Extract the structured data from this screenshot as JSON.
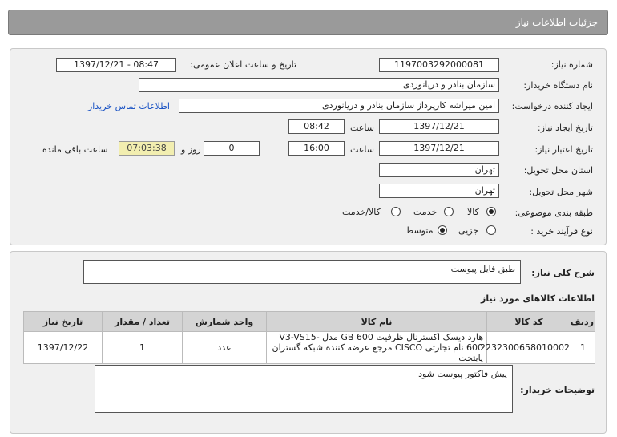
{
  "header": {
    "title": "جزئیات اطلاعات نیاز"
  },
  "info": {
    "need_number_label": "شماره نیاز:",
    "need_number": "1197003292000081",
    "announce_label": "تاریخ و ساعت اعلان عمومی:",
    "announce_value": "1397/12/21 - 08:47",
    "buyer_org_label": "نام دستگاه خریدار:",
    "buyer_org": "سازمان بنادر و دریانوردی",
    "requester_label": "ایجاد کننده درخواست:",
    "requester": "امین میراشه کارپرداز سازمان بنادر و دریانوردی",
    "contact_link": "اطلاعات تماس خریدار",
    "created_label": "تاریخ ایجاد نیاز:",
    "created_date": "1397/12/21",
    "time_label": "ساعت",
    "created_time": "08:42",
    "validity_label": "تاریخ اعتبار نیاز:",
    "validity_date": "1397/12/21",
    "validity_time": "16:00",
    "days_value": "0",
    "days_label": "روز و",
    "remaining_time": "07:03:38",
    "remaining_label": "ساعت باقی مانده",
    "province_label": "استان محل تحویل:",
    "province": "تهران",
    "city_label": "شهر محل تحویل:",
    "city": "تهران",
    "category_label": "طبقه بندی موضوعی:",
    "category_options": [
      "کالا",
      "خدمت",
      "کالا/خدمت"
    ],
    "category_selected": "کالا",
    "process_label": "نوع فرآیند خرید :",
    "process_options": [
      "جزیی",
      "متوسط"
    ],
    "process_selected": "متوسط"
  },
  "summary": {
    "label": "شرح کلی نیاز:",
    "value": "طبق فایل پیوست"
  },
  "goods": {
    "section_title": "اطلاعات کالاهای مورد نیاز",
    "columns": [
      "ردیف",
      "کد کالا",
      "نام کالا",
      "واحد شمارش",
      "تعداد / مقدار",
      "تاریخ نیاز"
    ],
    "rows": [
      {
        "row": "1",
        "code": "2232300658010002",
        "name": "هارد دیسک اکسترنال ظرفیت 600 GB مدل V3-VS15-600 نام تجارتی CISCO مرجع عرضه کننده شبکه گستران پایتخت",
        "unit": "عدد",
        "qty": "1",
        "date": "1397/12/22"
      }
    ]
  },
  "buyer_notes": {
    "label": "توضیحات خریدار:",
    "value": "پیش فاکتور پیوست شود"
  }
}
